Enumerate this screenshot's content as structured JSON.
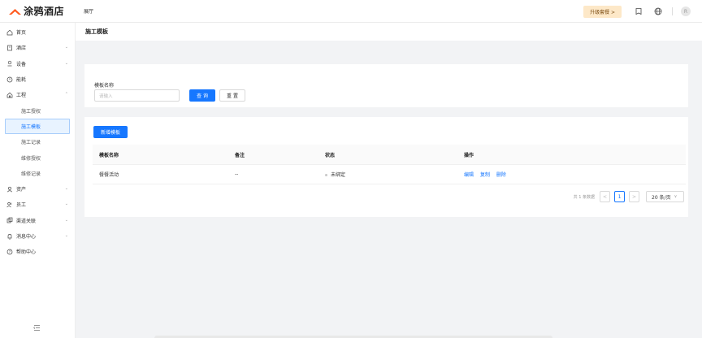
{
  "header": {
    "brand": "涂鸦酒店",
    "venue": "展厅",
    "upgrade_label": "升级套餐 >",
    "avatar_initial": "R",
    "brand_color": "#ff5a1f"
  },
  "sidebar": {
    "items": [
      {
        "label": "首页",
        "icon": "home-icon"
      },
      {
        "label": "酒店",
        "icon": "hotel-icon",
        "chevron": "⌄"
      },
      {
        "label": "设备",
        "icon": "device-icon",
        "chevron": "⌄"
      },
      {
        "label": "能耗",
        "icon": "energy-icon"
      },
      {
        "label": "工程",
        "icon": "engineering-icon",
        "chevron": "⌃"
      },
      {
        "label": "资产",
        "icon": "asset-icon",
        "chevron": "⌄"
      },
      {
        "label": "员工",
        "icon": "staff-icon",
        "chevron": "⌄"
      },
      {
        "label": "渠道关联",
        "icon": "channel-icon",
        "chevron": "⌄"
      },
      {
        "label": "消息中心",
        "icon": "bell-icon",
        "chevron": "⌄"
      },
      {
        "label": "帮助中心",
        "icon": "help-icon"
      }
    ],
    "sub_items": [
      {
        "label": "施工授权"
      },
      {
        "label": "施工模板"
      },
      {
        "label": "施工记录"
      },
      {
        "label": "维修授权"
      },
      {
        "label": "维修记录"
      }
    ],
    "active_sub": "施工模板",
    "accent": "#1677ff"
  },
  "page": {
    "title": "施工模板"
  },
  "search": {
    "field_label": "模板名称",
    "placeholder": "请输入",
    "query_label": "查 询",
    "reset_label": "重 置"
  },
  "table": {
    "add_label": "新增模板",
    "columns": [
      "模板名称",
      "备注",
      "状态",
      "操作"
    ],
    "rows": [
      {
        "name": "餐餐活动",
        "note": "--",
        "status": "未绑定",
        "actions": [
          "编辑",
          "复制",
          "删除"
        ]
      }
    ]
  },
  "pagination": {
    "total_text": "共 1 条数据",
    "current_page": "1",
    "prev": "<",
    "next": ">",
    "page_size": "20 条/页",
    "dropdown": "∨"
  }
}
